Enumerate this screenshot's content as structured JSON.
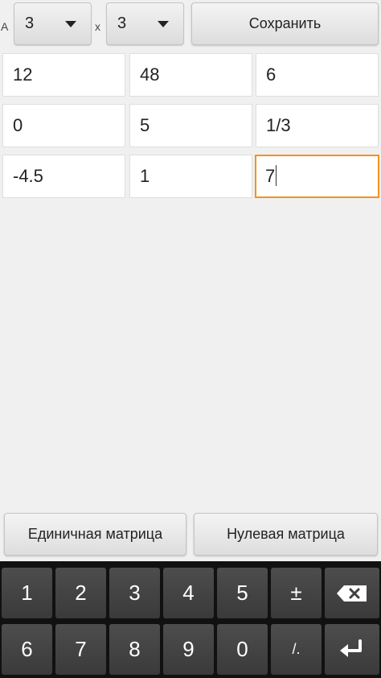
{
  "header": {
    "matrix_label": "A",
    "rows_value": "3",
    "times_label": "x",
    "cols_value": "3",
    "save_label": "Сохранить"
  },
  "matrix": {
    "rows": [
      [
        "12",
        "48",
        "6"
      ],
      [
        "0",
        "5",
        "1/3"
      ],
      [
        "-4.5",
        "1",
        "7"
      ]
    ]
  },
  "actions": {
    "identity_label": "Единичная матрица",
    "zero_label": "Нулевая матрица"
  },
  "keyboard": {
    "row1": [
      "1",
      "2",
      "3",
      "4",
      "5",
      "±"
    ],
    "row2": [
      "6",
      "7",
      "8",
      "9",
      "0",
      "/."
    ]
  },
  "colors": {
    "focus_border": "#f2941c",
    "keyboard_bg": "#111111"
  }
}
